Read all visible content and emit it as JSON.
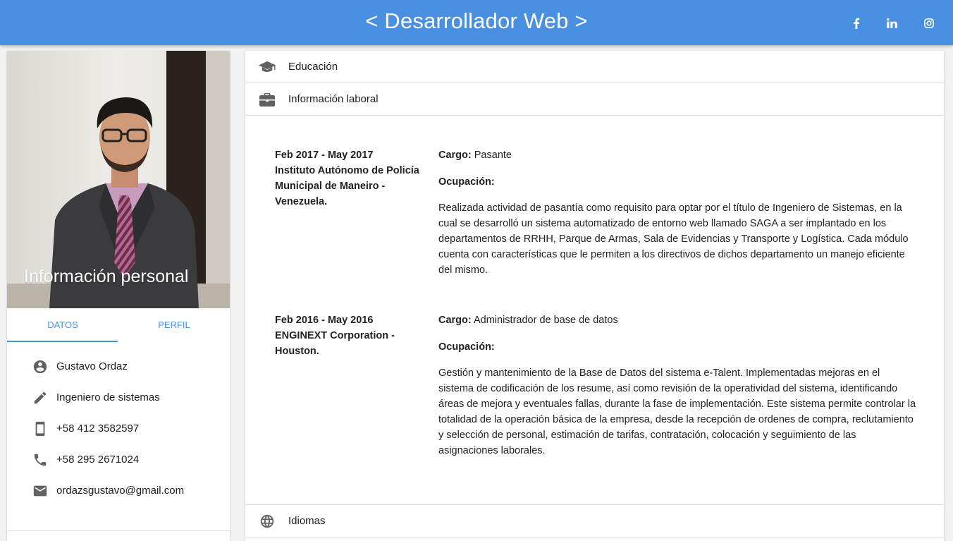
{
  "header": {
    "title": "< Desarrollador Web >",
    "social": [
      {
        "name": "facebook-icon",
        "glyph": "f"
      },
      {
        "name": "linkedin-icon",
        "glyph": "in"
      },
      {
        "name": "instagram-icon",
        "glyph": ""
      }
    ],
    "color": "#4a90e2"
  },
  "profile": {
    "caption": "Información personal",
    "tabs": [
      {
        "label": "DATOS",
        "active": true
      },
      {
        "label": "PERFIL",
        "active": false
      }
    ],
    "items": [
      {
        "icon": "account-circle-icon",
        "text": "Gustavo Ordaz"
      },
      {
        "icon": "pencil-icon",
        "text": "Ingeniero de sistemas"
      },
      {
        "icon": "smartphone-icon",
        "text": "+58 412 3582597"
      },
      {
        "icon": "phone-icon",
        "text": "+58 295 2671024"
      },
      {
        "icon": "email-icon",
        "text": "ordazsgustavo@gmail.com"
      }
    ]
  },
  "sections": {
    "education": {
      "label": "Educación",
      "icon": "graduation-cap-icon"
    },
    "work": {
      "label": "Información laboral",
      "icon": "briefcase-icon"
    },
    "languages": {
      "label": "Idiomas",
      "icon": "globe-icon"
    }
  },
  "jobs": [
    {
      "period": "Feb 2017 - May 2017",
      "place": "Instituto Autónomo de Policía Municipal de Maneiro - Venezuela.",
      "cargo_label": "Cargo:",
      "cargo": "Pasante",
      "ocupacion_label": "Ocupación:",
      "description": "Realizada actividad de pasantía como requisito para optar por el título de Ingeniero de Sistemas, en la cual se desarrolló un sistema automatizado de entorno web llamado SAGA a ser implantado en los departamentos de RRHH, Parque de Armas, Sala de Evidencias y Transporte y Logística. Cada módulo cuenta con características que le permiten a los directivos de dichos departamento un manejo eficiente del mismo."
    },
    {
      "period": "Feb 2016 - May 2016",
      "place": "ENGINEXT Corporation - Houston.",
      "cargo_label": "Cargo:",
      "cargo": "Administrador de base de datos",
      "ocupacion_label": "Ocupación:",
      "description": "Gestión y mantenimiento de la Base de Datos del sistema e-Talent. Implementadas mejoras en el sistema de codificación de los resume, así como revisión de la operatividad del sistema, identificando áreas de mejora y eventuales fallas, durante la fase de implementación. Este sistema permite controlar la totalidad de la operación básica de la empresa, desde la recepción de ordenes de compra, reclutamiento y selección de personal, estimación de tarifas, contratación, colocación y seguimiento de las asignaciones laborales."
    }
  ]
}
